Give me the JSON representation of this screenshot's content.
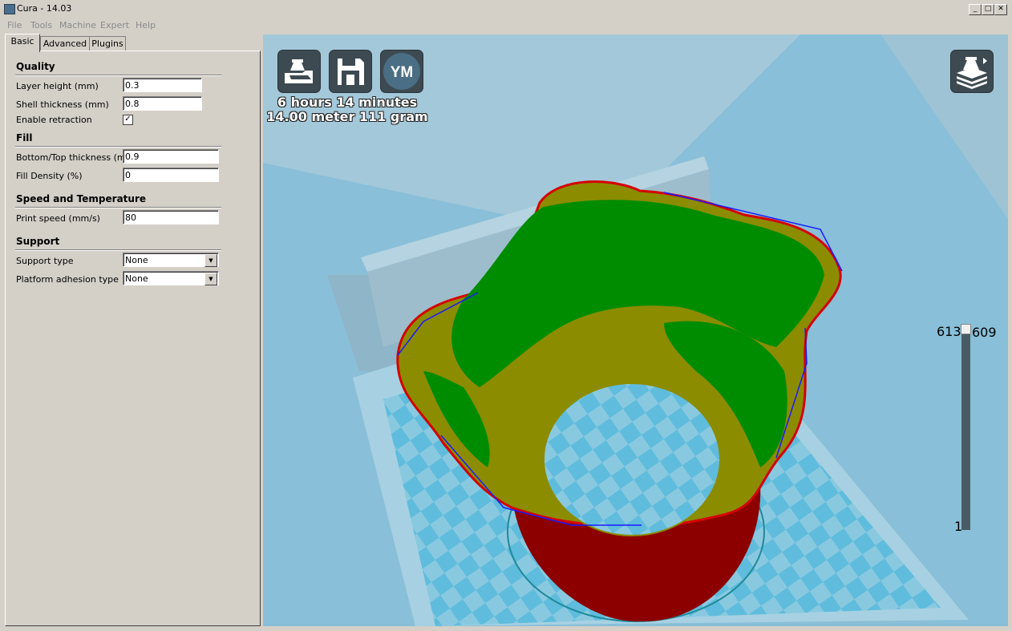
{
  "window": {
    "title": "Cura - 14.03",
    "minimize_glyph": "_",
    "maximize_glyph": "□",
    "close_glyph": "✕"
  },
  "menu": [
    "File",
    "Tools",
    "Machine",
    "Expert",
    "Help"
  ],
  "tabs": [
    "Basic",
    "Advanced",
    "Plugins"
  ],
  "sections": {
    "quality": "Quality",
    "fill": "Fill",
    "speed": "Speed and Temperature",
    "support": "Support"
  },
  "fields": {
    "layer_height": {
      "label": "Layer height (mm)",
      "value": "0.3"
    },
    "shell_thickness": {
      "label": "Shell thickness (mm)",
      "value": "0.8"
    },
    "enable_retraction": {
      "label": "Enable retraction",
      "checked": true,
      "glyph": "✓"
    },
    "bottom_top": {
      "label": "Bottom/Top thickness (mm)",
      "value": "0.9"
    },
    "fill_density": {
      "label": "Fill Density (%)",
      "value": "0"
    },
    "print_speed": {
      "label": "Print speed (mm/s)",
      "value": "80"
    },
    "support_type": {
      "label": "Support type",
      "value": "None"
    },
    "adhesion": {
      "label": "Platform adhesion type",
      "value": "None"
    }
  },
  "viewport": {
    "toolbar_icons": [
      "load-model-icon",
      "save-gcode-icon",
      "youmagine-icon",
      "view-mode-icon"
    ],
    "ym_label": "YM",
    "print_time": "6 hours 14 minutes",
    "print_material": "14.00 meter 111 gram",
    "layer_max": "613",
    "layer_current": "609",
    "layer_min": "1",
    "layer_position": 0.994
  },
  "colors": {
    "viewport_bg": "#89bfd8",
    "model_green": "#008c00",
    "model_olive": "#8c8c00",
    "model_red": "#8c0000",
    "button_bg": "#3d4a52"
  }
}
